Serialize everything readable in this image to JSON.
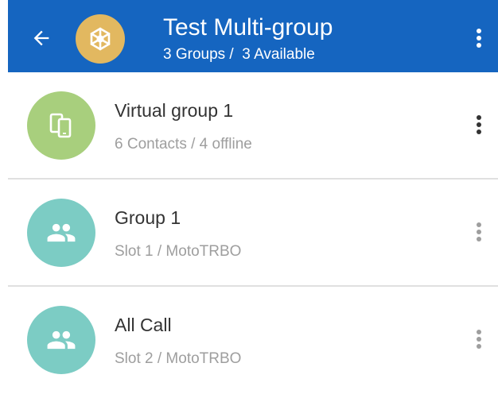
{
  "header": {
    "title": "Test Multi-group",
    "subtitle": "3 Groups /  3 Available",
    "back_icon": "arrow-left-icon",
    "avatar_icon": "network-hub-icon",
    "menu_icon": "more-vertical-icon",
    "colors": {
      "bar": "#1565C0",
      "avatar": "#E2B860"
    }
  },
  "groups": [
    {
      "title": "Virtual group 1",
      "subtitle": "6 Contacts / 4 offline",
      "icon": "devices-icon",
      "avatar_color": "#A8CF7D",
      "menu_color": "#333333"
    },
    {
      "title": "Group 1",
      "subtitle": "Slot 1 / MotoTRBO",
      "icon": "people-icon",
      "avatar_color": "#7CCCC4",
      "menu_color": "#9E9E9E"
    },
    {
      "title": "All Call",
      "subtitle": "Slot 2 / MotoTRBO",
      "icon": "people-icon",
      "avatar_color": "#7CCCC4",
      "menu_color": "#9E9E9E"
    }
  ]
}
